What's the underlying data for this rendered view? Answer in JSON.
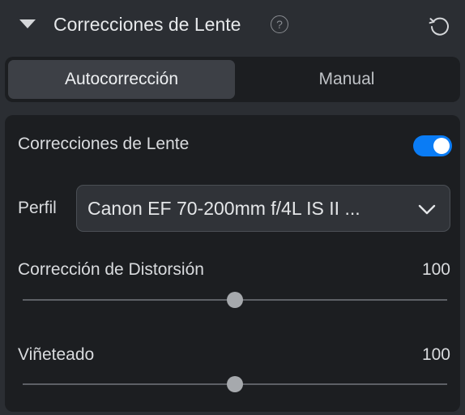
{
  "header": {
    "title": "Correcciones de Lente",
    "help_icon": "question-circle-icon",
    "help_glyph": "?",
    "reset_icon": "rotate-ccw-icon",
    "collapse_icon": "triangle-down-icon"
  },
  "segmented": {
    "options": [
      {
        "label": "Autocorrección",
        "selected": true
      },
      {
        "label": "Manual",
        "selected": false
      }
    ]
  },
  "settings": {
    "enable_label": "Correcciones de Lente",
    "enable_on": true,
    "profile": {
      "label": "Perfil",
      "value": "Canon EF 70-200mm f/4L IS II ..."
    },
    "distortion": {
      "label": "Corrección de Distorsión",
      "value": "100",
      "fraction": 0.5
    },
    "vignetting": {
      "label": "Viñeteado",
      "value": "100",
      "fraction": 0.5
    }
  },
  "colors": {
    "accent": "#0a7cf5",
    "panel": "#2b2e33",
    "card": "#1c1e21"
  }
}
